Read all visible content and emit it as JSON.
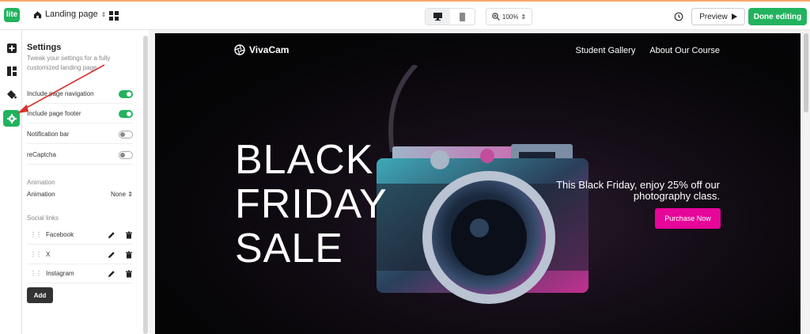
{
  "topbar": {
    "logo": "lite",
    "page_name": "Landing page",
    "zoom": "100%",
    "preview_label": "Preview",
    "done_label": "Done editing"
  },
  "settings": {
    "title": "Settings",
    "subtitle": "Tweak your settings for a fully customized landing page",
    "toggles": [
      {
        "label": "Include page navigation",
        "on": true
      },
      {
        "label": "Include page footer",
        "on": true
      },
      {
        "label": "Notification bar",
        "on": false
      },
      {
        "label": "reCaptcha",
        "on": false
      }
    ],
    "animation_section": "Animation",
    "animation_label": "Animation",
    "animation_value": "None",
    "social_section": "Social links",
    "social_links": [
      {
        "label": "Facebook"
      },
      {
        "label": "X"
      },
      {
        "label": "Instagram"
      }
    ],
    "add_label": "Add"
  },
  "site": {
    "brand": "VivaCam",
    "nav": [
      "Student Gallery",
      "About Our Course"
    ],
    "hero_line1": "BLACK",
    "hero_line2": "FRIDAY",
    "hero_line3": "SALE",
    "promo_text": "This Black Friday, enjoy 25% off our photography class.",
    "cta_label": "Purchase Now"
  },
  "colors": {
    "accent": "#22b35e",
    "cta": "#e6069a",
    "annotation": "#d9302c"
  }
}
